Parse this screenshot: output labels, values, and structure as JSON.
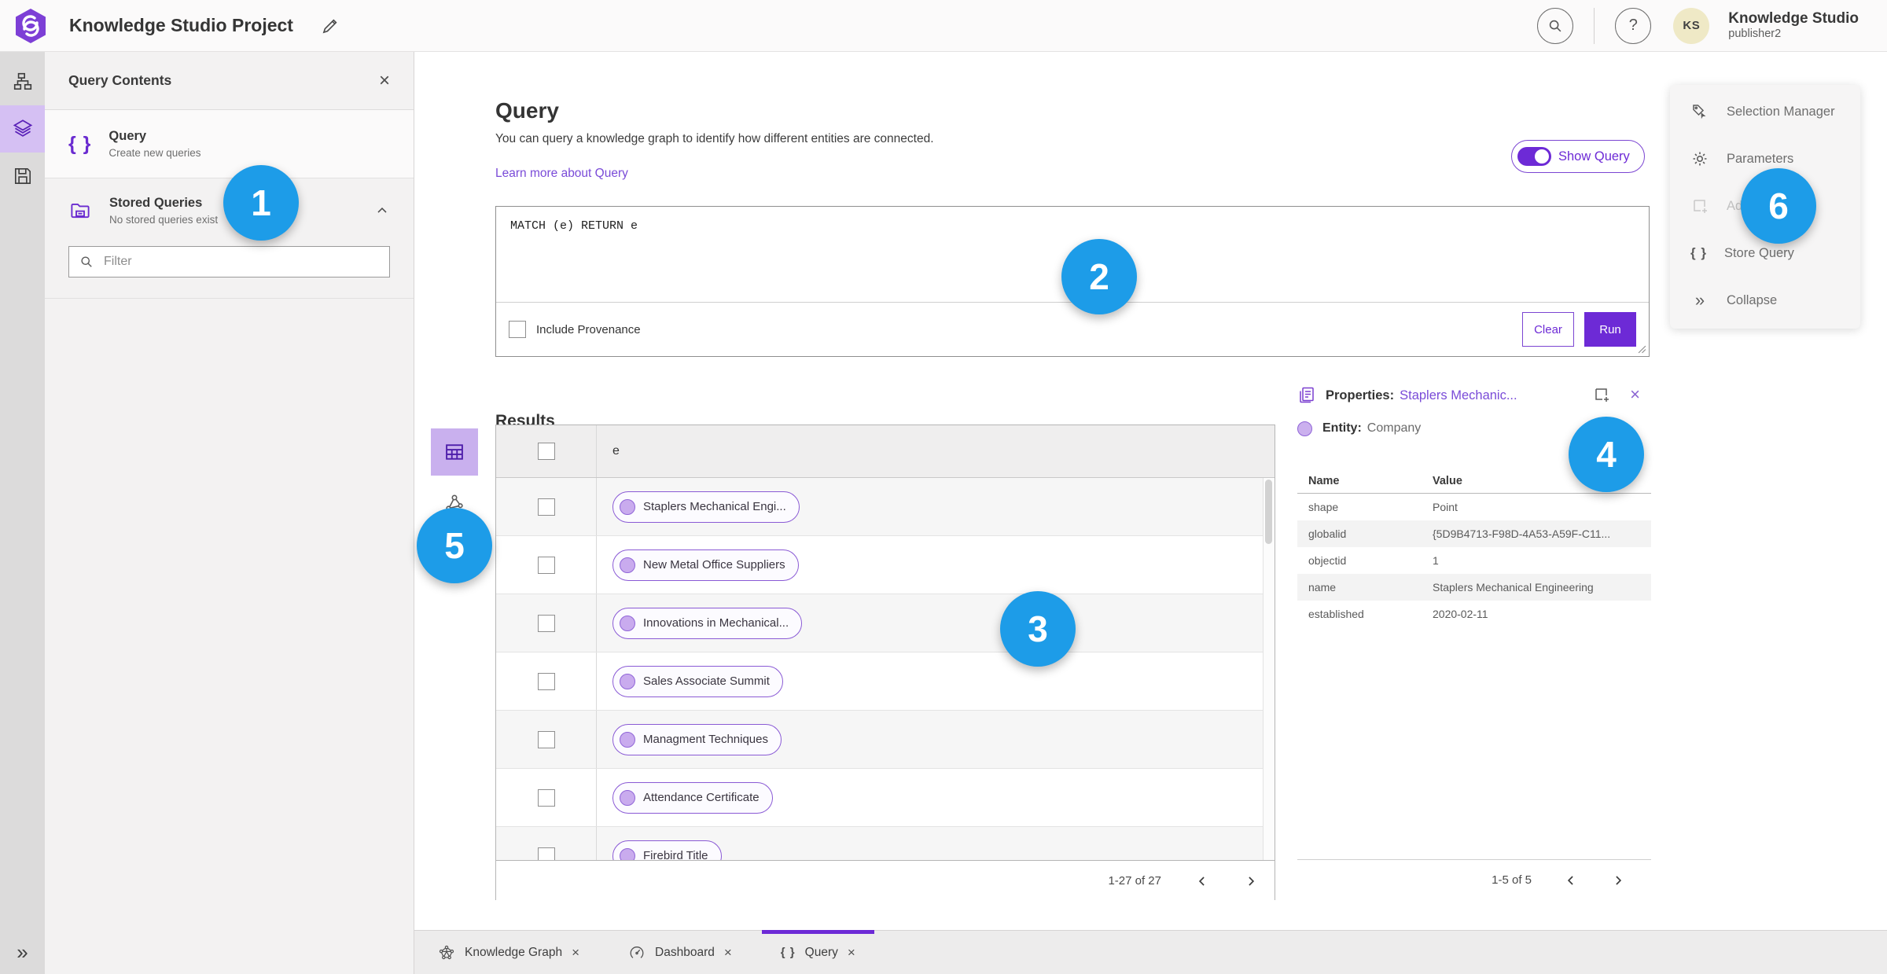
{
  "header": {
    "title": "Knowledge Studio Project",
    "user_name": "Knowledge Studio",
    "user_role": "publisher2",
    "avatar_initials": "KS",
    "help_glyph": "?"
  },
  "ui": {
    "close_glyph": "×",
    "expand_glyph": "»",
    "braces_glyph": "{ }"
  },
  "left_panel": {
    "title": "Query Contents",
    "query_item": {
      "label": "Query",
      "sublabel": "Create new queries"
    },
    "stored_queries": {
      "label": "Stored Queries",
      "sublabel": "No stored queries exist"
    },
    "filter_placeholder": "Filter"
  },
  "query_section": {
    "title": "Query",
    "description": "You can query a knowledge graph to identify how different entities are connected.",
    "learn_more": "Learn more about Query",
    "show_query_label": "Show Query",
    "query_text": "MATCH (e) RETURN e",
    "include_provenance_label": "Include Provenance",
    "clear_label": "Clear",
    "run_label": "Run"
  },
  "results": {
    "title": "Results",
    "column_header": "e",
    "rows": [
      {
        "label": "Staplers Mechanical Engi..."
      },
      {
        "label": "New Metal Office Suppliers"
      },
      {
        "label": "Innovations in Mechanical..."
      },
      {
        "label": "Sales Associate Summit"
      },
      {
        "label": "Managment Techniques"
      },
      {
        "label": "Attendance Certificate"
      },
      {
        "label": "Firebird Title"
      }
    ],
    "pagination": "1-27 of 27"
  },
  "properties_panel": {
    "title_prefix": "Properties:",
    "title_link": "Staplers Mechanic...",
    "entity_prefix": "Entity:",
    "entity_type": "Company",
    "columns": {
      "name": "Name",
      "value": "Value"
    },
    "rows": [
      {
        "name": "shape",
        "value": "Point"
      },
      {
        "name": "globalid",
        "value": "{5D9B4713-F98D-4A53-A59F-C11..."
      },
      {
        "name": "objectid",
        "value": "1"
      },
      {
        "name": "name",
        "value": "Staplers Mechanical Engineering"
      },
      {
        "name": "established",
        "value": "2020-02-11"
      }
    ],
    "pagination": "1-5 of 5"
  },
  "right_menu": {
    "items": [
      {
        "label": "Selection Manager"
      },
      {
        "label": "Parameters"
      },
      {
        "label": "Add"
      },
      {
        "label": "Store Query"
      },
      {
        "label": "Collapse"
      }
    ]
  },
  "tabs": [
    {
      "label": "Knowledge Graph"
    },
    {
      "label": "Dashboard"
    },
    {
      "label": "Query"
    }
  ],
  "badges": [
    "1",
    "2",
    "3",
    "4",
    "5",
    "6"
  ],
  "colors": {
    "accent_purple": "#6d2ad6",
    "link_purple": "#7a4bd8",
    "badge_blue": "#1d9ce8",
    "rail_selected": "#d5c0f3",
    "pill_border": "#8a5ad5",
    "entity_fill": "#c9abee"
  }
}
